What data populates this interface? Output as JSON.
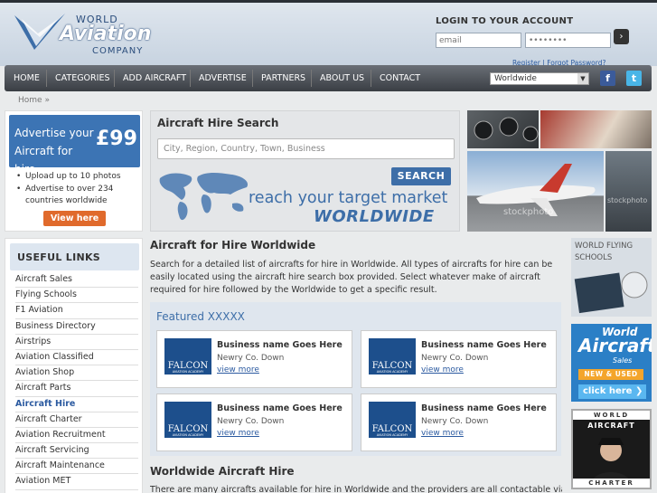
{
  "logo": {
    "line1": "WORLD",
    "line2": "Aviation",
    "line3": "COMPANY"
  },
  "login": {
    "title": "LOGIN TO YOUR ACCOUNT",
    "email_placeholder": "email",
    "password_value": "••••••••",
    "submit_icon": "chevron-right-icon",
    "register": "Register",
    "separator": " | ",
    "forgot": "Forgot Password?"
  },
  "nav": {
    "items": [
      "HOME",
      "CATEGORIES",
      "ADD AIRCRAFT",
      "ADVERTISE",
      "PARTNERS",
      "ABOUT US",
      "CONTACT"
    ],
    "region_select": "Worldwide",
    "facebook_letter": "f",
    "twitter_letter": "t"
  },
  "breadcrumb": {
    "home": "Home",
    "sep": "»"
  },
  "advertise": {
    "text": "Advertise your Aircraft for hire",
    "price": "£99",
    "bullets": [
      "Upload up to 10 photos",
      "Advertise to over 234 countries worldwide"
    ],
    "button": "View here"
  },
  "useful_links": {
    "title": "USEFUL LINKS",
    "items": [
      "Aircraft Sales",
      "Flying Schools",
      "F1 Aviation",
      "Business Directory",
      "Airstrips",
      "Aviation Classified",
      "Aviation Shop",
      "Aircraft Parts",
      "Aircraft Hire",
      "Aircraft Charter",
      "Aviation Recruitment",
      "Aircraft Servicing",
      "Aircraft Maintenance",
      "Aviation MET"
    ]
  },
  "search": {
    "title": "Aircraft Hire Search",
    "placeholder": "City, Region, Country, Town, Business",
    "button": "SEARCH",
    "tagline1": "reach your target market",
    "tagline2": "WORLDWIDE"
  },
  "main": {
    "heading": "Aircraft for Hire Worldwide",
    "intro": "Search for a detailed list of aircrafts for hire in Worldwide. All types of aircrafts for hire can be easily located using the aircraft hire search box provided. Select whatever make of aircraft required for hire followed by the Worldwide to get a specific result.",
    "featured_title": "Featured XXXXX",
    "businesses": [
      {
        "name": "Business name Goes Here",
        "location": "Newry Co. Down",
        "link": "view more",
        "logo": "FALCON",
        "logo_sub": "AVIATION ACADEMY"
      },
      {
        "name": "Business name Goes Here",
        "location": "Newry Co. Down",
        "link": "view more",
        "logo": "FALCON",
        "logo_sub": "AVIATION ACADEMY"
      },
      {
        "name": "Business name Goes Here",
        "location": "Newry Co. Down",
        "link": "view more",
        "logo": "FALCON",
        "logo_sub": "AVIATION ACADEMY"
      },
      {
        "name": "Business name Goes Here",
        "location": "Newry Co. Down",
        "link": "view more",
        "logo": "FALCON",
        "logo_sub": "AVIATION ACADEMY"
      }
    ],
    "heading2": "Worldwide Aircraft Hire",
    "para2": "There are many aircrafts available for hire in Worldwide and the providers are all contactable via"
  },
  "side_ads": {
    "schools": "WORLD FLYING SCHOOLS",
    "sales1": "World",
    "sales2": "Aircraft",
    "sales3": "Sales",
    "sales4": "NEW & USED",
    "sales5": "click here ❯",
    "charter1": "WORLD",
    "charter2": "AIRCRAFT",
    "charter3": "CHARTER"
  },
  "photo_watermark": "stockphoto",
  "colors": {
    "accent": "#3d6ea8",
    "orange": "#e06a2c",
    "nav_dark": "#3a3e44"
  }
}
